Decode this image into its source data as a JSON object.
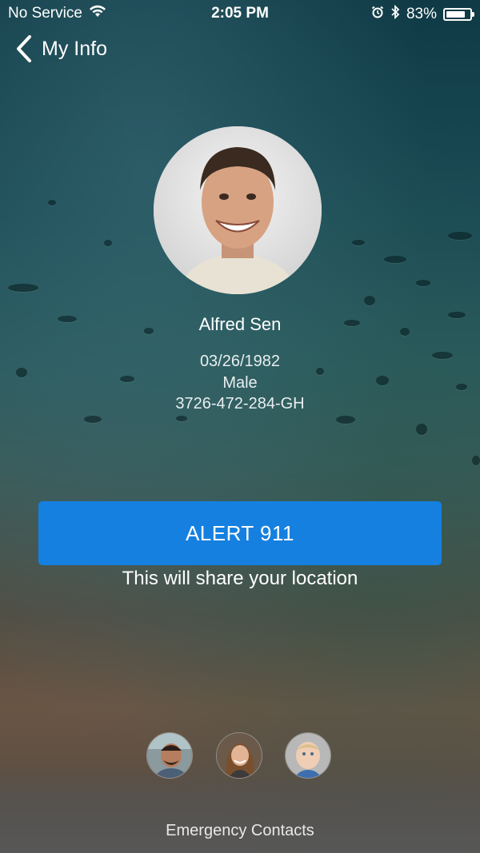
{
  "status_bar": {
    "carrier": "No Service",
    "time": "2:05 PM",
    "battery_percent": "83%",
    "battery_level": 0.83,
    "icons": [
      "wifi-icon",
      "alarm-icon",
      "bluetooth-icon",
      "battery-icon"
    ]
  },
  "nav": {
    "back_label": "My Info"
  },
  "profile": {
    "name": "Alfred Sen",
    "dob": "03/26/1982",
    "gender": "Male",
    "id": "3726-472-284-GH"
  },
  "alert": {
    "button_label": "ALERT 911",
    "subtext": "This will share your location",
    "color": "#1580e0"
  },
  "contacts": {
    "label": "Emergency Contacts",
    "items": [
      {
        "name": "contact-1"
      },
      {
        "name": "contact-2"
      },
      {
        "name": "contact-3"
      }
    ]
  }
}
